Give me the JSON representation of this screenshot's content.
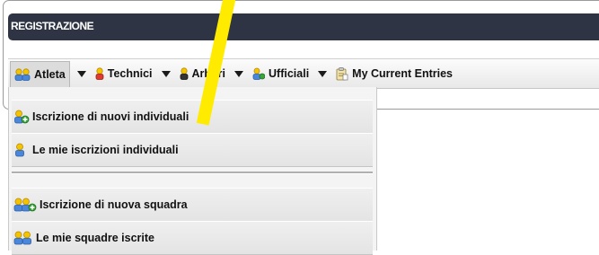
{
  "panel": {
    "title": "REGISTRAZIONE"
  },
  "menubar": {
    "items": [
      {
        "label": "Atleta",
        "icon": "two-people-icon",
        "has_dropdown": true
      },
      {
        "label": "Technici",
        "icon": "person-red-icon",
        "has_dropdown": true
      },
      {
        "label": "Arbitri",
        "icon": "person-dark-icon",
        "has_dropdown": true
      },
      {
        "label": "Ufficiali",
        "icon": "person-group-icon",
        "has_dropdown": true
      },
      {
        "label": "My Current Entries",
        "icon": "clipboard-icon",
        "has_dropdown": false
      }
    ]
  },
  "dropdown": {
    "items": [
      {
        "label": "Iscrizione di nuovi individuali",
        "icon": "person-add-icon"
      },
      {
        "label": "Le mie iscrizioni individuali",
        "icon": "person-icon"
      },
      {
        "label": "Iscrizione di nuova squadra",
        "icon": "team-add-icon"
      },
      {
        "label": "Le mie squadre iscrite",
        "icon": "team-icon"
      }
    ]
  },
  "colors": {
    "header_bg": "#2e3443",
    "accent_yellow": "#ffeb00",
    "person_head": "#f5c400",
    "person_body": "#4a86d9",
    "add_green": "#3aa53a"
  }
}
